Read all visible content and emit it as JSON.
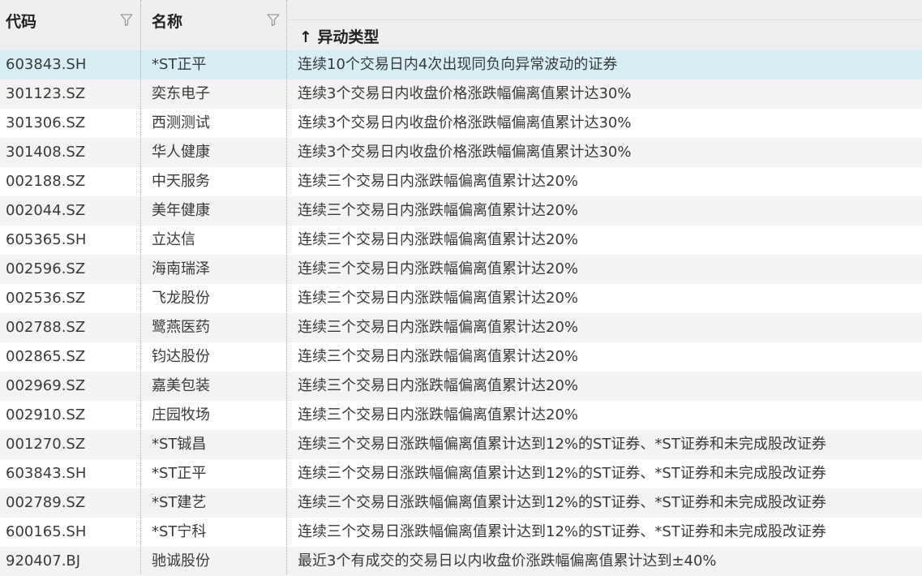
{
  "header": {
    "code": "代码",
    "name": "名称",
    "type": "↑ 异动类型"
  },
  "icons": {
    "filter": "filter-funnel-icon"
  },
  "colors": {
    "header_bg": "#efefef",
    "selected_row": "#d8eef5",
    "alt_row": "#f3f3f3"
  },
  "rows": [
    {
      "code": "603843.SH",
      "name": "*ST正平",
      "type": "连续10个交易日内4次出现同负向异常波动的证券"
    },
    {
      "code": "301123.SZ",
      "name": "奕东电子",
      "type": "连续3个交易日内收盘价格涨跌幅偏离值累计达30%"
    },
    {
      "code": "301306.SZ",
      "name": "西测测试",
      "type": "连续3个交易日内收盘价格涨跌幅偏离值累计达30%"
    },
    {
      "code": "301408.SZ",
      "name": "华人健康",
      "type": "连续3个交易日内收盘价格涨跌幅偏离值累计达30%"
    },
    {
      "code": "002188.SZ",
      "name": "中天服务",
      "type": "连续三个交易日内涨跌幅偏离值累计达20%"
    },
    {
      "code": "002044.SZ",
      "name": "美年健康",
      "type": "连续三个交易日内涨跌幅偏离值累计达20%"
    },
    {
      "code": "605365.SH",
      "name": "立达信",
      "type": "连续三个交易日内涨跌幅偏离值累计达20%"
    },
    {
      "code": "002596.SZ",
      "name": "海南瑞泽",
      "type": "连续三个交易日内涨跌幅偏离值累计达20%"
    },
    {
      "code": "002536.SZ",
      "name": "飞龙股份",
      "type": "连续三个交易日内涨跌幅偏离值累计达20%"
    },
    {
      "code": "002788.SZ",
      "name": "鹭燕医药",
      "type": "连续三个交易日内涨跌幅偏离值累计达20%"
    },
    {
      "code": "002865.SZ",
      "name": "钧达股份",
      "type": "连续三个交易日内涨跌幅偏离值累计达20%"
    },
    {
      "code": "002969.SZ",
      "name": "嘉美包装",
      "type": "连续三个交易日内涨跌幅偏离值累计达20%"
    },
    {
      "code": "002910.SZ",
      "name": "庄园牧场",
      "type": "连续三个交易日内涨跌幅偏离值累计达20%"
    },
    {
      "code": "001270.SZ",
      "name": "*ST铖昌",
      "type": "连续三个交易日涨跌幅偏离值累计达到12%的ST证券、*ST证券和未完成股改证券"
    },
    {
      "code": "603843.SH",
      "name": "*ST正平",
      "type": "连续三个交易日涨跌幅偏离值累计达到12%的ST证券、*ST证券和未完成股改证券"
    },
    {
      "code": "002789.SZ",
      "name": "*ST建艺",
      "type": "连续三个交易日涨跌幅偏离值累计达到12%的ST证券、*ST证券和未完成股改证券"
    },
    {
      "code": "600165.SH",
      "name": "*ST宁科",
      "type": "连续三个交易日涨跌幅偏离值累计达到12%的ST证券、*ST证券和未完成股改证券"
    },
    {
      "code": "920407.BJ",
      "name": "驰诚股份",
      "type": "最近3个有成交的交易日以内收盘价涨跌幅偏离值累计达到±40%"
    }
  ]
}
